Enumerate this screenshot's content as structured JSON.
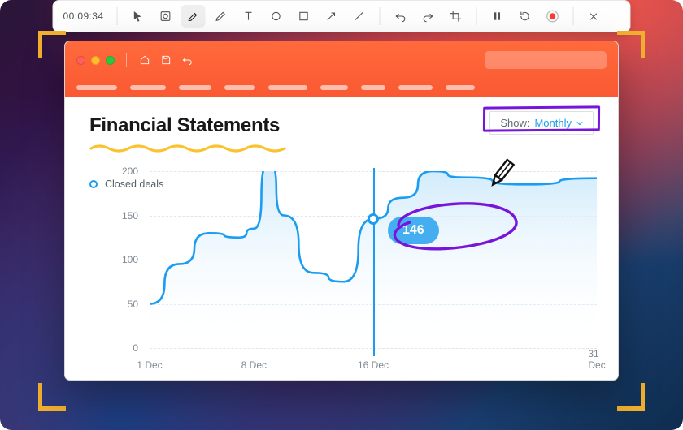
{
  "toolbar": {
    "timer": "00:09:34",
    "icons": [
      "pointer-icon",
      "capture-area-icon",
      "highlighter-icon",
      "pencil-icon",
      "text-icon",
      "circle-icon",
      "square-icon",
      "arrow-icon",
      "line-icon",
      "undo-icon",
      "redo-icon",
      "crop-icon",
      "pause-icon",
      "restart-icon",
      "record-icon",
      "close-icon"
    ],
    "active_tool_index": 2
  },
  "app": {
    "window_controls": [
      "close",
      "minimize",
      "zoom"
    ],
    "quick_icons": [
      "home-icon",
      "save-icon",
      "undo-icon"
    ],
    "search": {
      "placeholder": ""
    },
    "ribbon_tab_count": 9
  },
  "page": {
    "title": "Financial Statements",
    "filter": {
      "label": "Show:",
      "value": "Monthly"
    }
  },
  "chart_data": {
    "type": "line",
    "title": "",
    "legend": [
      "Closed deals"
    ],
    "xlabel": "",
    "ylabel": "",
    "ylim": [
      0,
      200
    ],
    "y_ticks": [
      0,
      50,
      100,
      150,
      200
    ],
    "x_ticks": [
      "1 Dec",
      "8 Dec",
      "16 Dec",
      "31 Dec"
    ],
    "series": [
      {
        "name": "Closed deals",
        "x": [
          1,
          3,
          5,
          7,
          8,
          9,
          10,
          12,
          14,
          16,
          18,
          20,
          22,
          26,
          31
        ],
        "values": [
          50,
          95,
          130,
          125,
          135,
          210,
          150,
          85,
          75,
          146,
          170,
          200,
          193,
          185,
          192
        ]
      }
    ],
    "marker": {
      "x": 16,
      "value": 146
    },
    "colors": {
      "line": "#1a9df1",
      "fill_top": "#cde9fb",
      "fill_bottom": "#ffffff",
      "grid": "#e3e6e8",
      "tick": "#808a93"
    }
  },
  "annotations": {
    "title_underline_color": "#f9c22e",
    "filter_box_color": "#7815db",
    "ellipse_color": "#7815db",
    "pencil_color": "#111111"
  }
}
